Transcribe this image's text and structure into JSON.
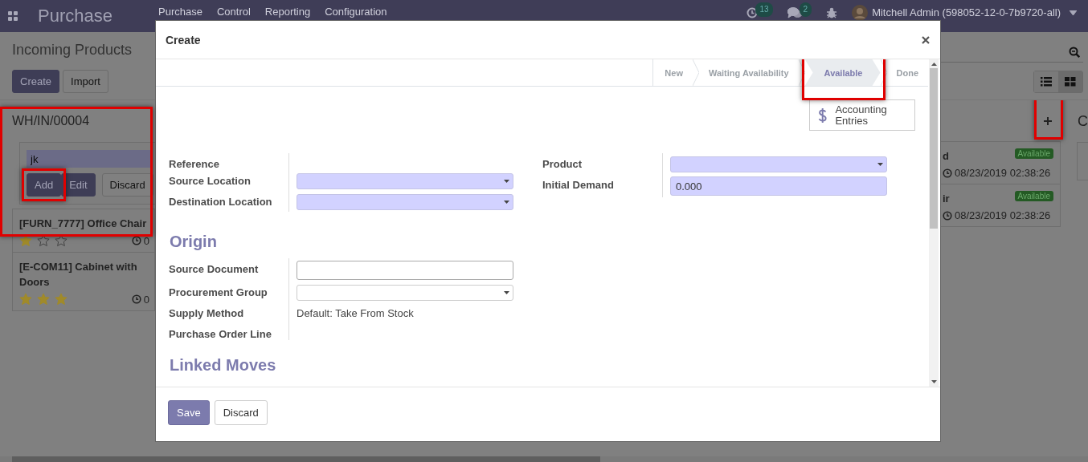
{
  "navbar": {
    "app_name": "Purchase",
    "menu": [
      "Purchase",
      "Control",
      "Reporting",
      "Configuration"
    ],
    "activity_count": "13",
    "message_count": "2",
    "user": "Mitchell Admin (598052-12-0-7b9720-all)"
  },
  "control_panel": {
    "title": "Incoming Products",
    "buttons": [
      {
        "label": "Create",
        "kind": "primary"
      },
      {
        "label": "Import",
        "kind": "secondary"
      }
    ],
    "views": [
      {
        "kind": "list",
        "selected": false
      },
      {
        "kind": "kanban",
        "selected": true
      }
    ]
  },
  "kanban": {
    "columns": [
      {
        "title": "WH/IN/00004",
        "highlighted": true,
        "quick_create": {
          "value": "jk",
          "buttons": [
            {
              "label": "Add",
              "kind": "primary",
              "highlighted": true
            },
            {
              "label": "Edit",
              "kind": "primary",
              "highlighted": false
            },
            {
              "label": "Discard",
              "kind": "secondary",
              "highlighted": false
            }
          ]
        },
        "cards": [
          {
            "name": "[FURN_7777] Office Chair",
            "stars": 1,
            "date": "0"
          },
          {
            "name": "[E-COM11] Cabinet with Doors",
            "stars": 3,
            "date": "0"
          }
        ]
      },
      {
        "add_highlighted": true,
        "cards": [
          {
            "name": "d",
            "badge": "Available",
            "date": "08/23/2019 02:38:26"
          },
          {
            "name": "ir",
            "badge": "Available",
            "date": "08/23/2019 02:38:26"
          }
        ]
      },
      {
        "title": "C"
      }
    ]
  },
  "dialog": {
    "title": "Create",
    "status_steps": [
      {
        "label": "New",
        "selected": false,
        "highlighted": false
      },
      {
        "label": "Waiting Availability",
        "selected": false,
        "highlighted": false
      },
      {
        "label": "Available",
        "selected": true,
        "highlighted": true
      },
      {
        "label": "Done",
        "selected": false,
        "highlighted": false
      }
    ],
    "smart_button": {
      "label": "Accounting Entries"
    },
    "sections": [
      {
        "groups": [
          [
            {
              "label": "Reference",
              "kind": "empty"
            },
            {
              "label": "Source Location",
              "kind": "select",
              "required": true
            },
            {
              "label": "Destination Location",
              "kind": "select",
              "required": true
            }
          ],
          [
            {
              "label": "Product",
              "kind": "select",
              "required": true
            },
            {
              "label": "Initial Demand",
              "kind": "input",
              "required": true,
              "value": "0.000"
            }
          ]
        ]
      },
      {
        "title": "Origin",
        "groups": [
          [
            {
              "label": "Source Document",
              "kind": "input",
              "required": false
            },
            {
              "label": "Procurement Group",
              "kind": "select",
              "required": false
            },
            {
              "label": "Supply Method",
              "kind": "text",
              "value": "Default: Take From Stock"
            },
            {
              "label": "Purchase Order Line",
              "kind": "empty"
            }
          ]
        ]
      },
      {
        "title": "Linked Moves"
      }
    ],
    "footer_buttons": [
      {
        "label": "Save",
        "kind": "primary"
      },
      {
        "label": "Discard",
        "kind": "secondary"
      }
    ]
  }
}
